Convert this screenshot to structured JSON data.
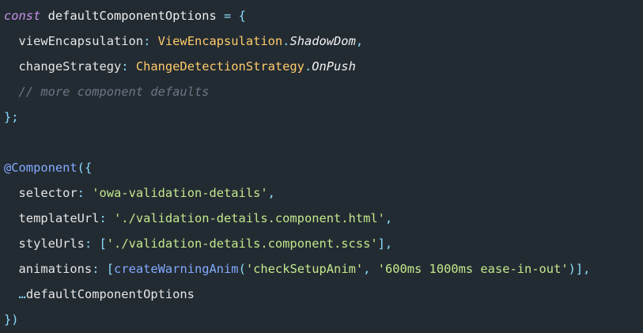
{
  "editor": {
    "colors": {
      "background": "#232b32",
      "keyword": "#c792ea",
      "operator": "#89ddff",
      "type": "#ffcb6b",
      "string": "#c3e88d",
      "function": "#82aaff",
      "comment": "#697886",
      "text": "#e6e6e6"
    },
    "lines": [
      [
        {
          "t": "const",
          "k": "keyword"
        },
        {
          "t": " defaultComponentOptions ",
          "k": "ident"
        },
        {
          "t": "=",
          "k": "op"
        },
        {
          "t": " ",
          "k": "plain"
        },
        {
          "t": "{",
          "k": "punct"
        }
      ],
      [
        {
          "t": "  viewEncapsulation",
          "k": "prop"
        },
        {
          "t": ":",
          "k": "op"
        },
        {
          "t": " ",
          "k": "plain"
        },
        {
          "t": "ViewEncapsulation",
          "k": "type"
        },
        {
          "t": ".",
          "k": "op"
        },
        {
          "t": "ShadowDom",
          "k": "member"
        },
        {
          "t": ",",
          "k": "op"
        }
      ],
      [
        {
          "t": "  changeStrategy",
          "k": "prop"
        },
        {
          "t": ":",
          "k": "op"
        },
        {
          "t": " ",
          "k": "plain"
        },
        {
          "t": "ChangeDetectionStrategy",
          "k": "type"
        },
        {
          "t": ".",
          "k": "op"
        },
        {
          "t": "OnPush",
          "k": "member"
        }
      ],
      [
        {
          "t": "  // more component defaults",
          "k": "comment"
        }
      ],
      [
        {
          "t": "};",
          "k": "punct"
        }
      ],
      [],
      [
        {
          "t": "@Component",
          "k": "decorator"
        },
        {
          "t": "({",
          "k": "punct"
        }
      ],
      [
        {
          "t": "  selector",
          "k": "prop"
        },
        {
          "t": ":",
          "k": "op"
        },
        {
          "t": " ",
          "k": "plain"
        },
        {
          "t": "'owa-validation-details'",
          "k": "string"
        },
        {
          "t": ",",
          "k": "op"
        }
      ],
      [
        {
          "t": "  templateUrl",
          "k": "prop"
        },
        {
          "t": ":",
          "k": "op"
        },
        {
          "t": " ",
          "k": "plain"
        },
        {
          "t": "'./validation-details.component.html'",
          "k": "string"
        },
        {
          "t": ",",
          "k": "op"
        }
      ],
      [
        {
          "t": "  styleUrls",
          "k": "prop"
        },
        {
          "t": ":",
          "k": "op"
        },
        {
          "t": " ",
          "k": "plain"
        },
        {
          "t": "[",
          "k": "punct"
        },
        {
          "t": "'./validation-details.component.scss'",
          "k": "string"
        },
        {
          "t": "],",
          "k": "punct"
        }
      ],
      [
        {
          "t": "  animations",
          "k": "prop"
        },
        {
          "t": ":",
          "k": "op"
        },
        {
          "t": " ",
          "k": "plain"
        },
        {
          "t": "[",
          "k": "punct"
        },
        {
          "t": "createWarningAnim",
          "k": "func"
        },
        {
          "t": "(",
          "k": "punct"
        },
        {
          "t": "'checkSetupAnim'",
          "k": "string"
        },
        {
          "t": ",",
          "k": "op"
        },
        {
          "t": " ",
          "k": "plain"
        },
        {
          "t": "'600ms 1000ms ease-in-out'",
          "k": "string"
        },
        {
          "t": ")],",
          "k": "punct"
        }
      ],
      [
        {
          "t": "  ",
          "k": "plain"
        },
        {
          "t": "…",
          "k": "op"
        },
        {
          "t": "defaultComponentOptions",
          "k": "plain"
        }
      ],
      [
        {
          "t": "})",
          "k": "punct"
        }
      ]
    ]
  }
}
